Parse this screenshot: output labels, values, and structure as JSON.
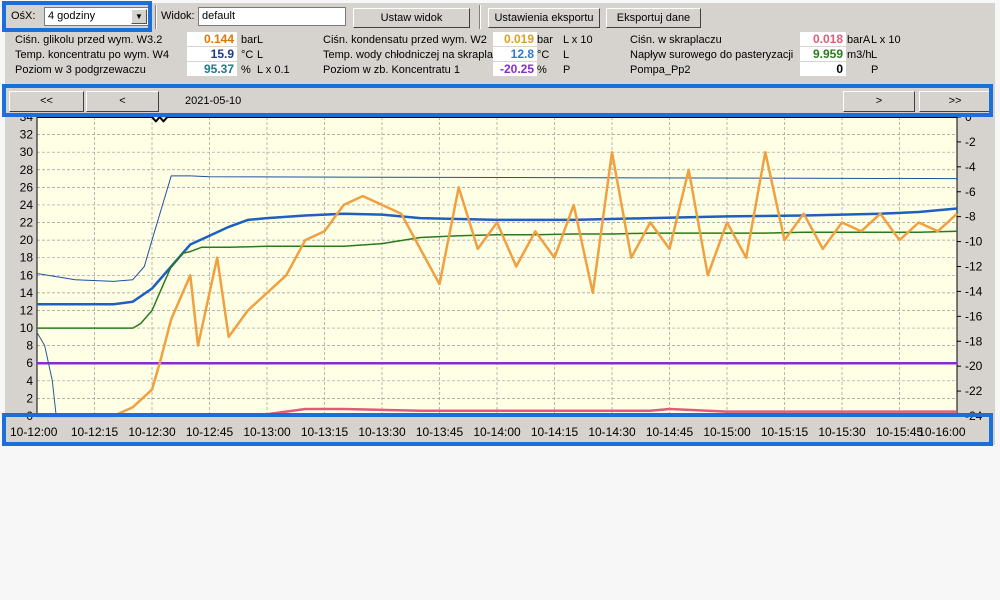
{
  "toolbar": {
    "osx_label": "OśX:",
    "range_value": "4 godziny",
    "view_label": "Widok:",
    "view_value": "default",
    "set_view_button": "Ustaw widok",
    "export_settings_button": "Ustawienia eksportu",
    "export_button": "Eksportuj dane"
  },
  "values": [
    {
      "label": "Ciśn. glikolu przed wym. W3.2",
      "value": "0.144",
      "unit": "bar",
      "scale": "L",
      "color": "#e07800"
    },
    {
      "label": "Temp. koncentratu po wym. W4",
      "value": "15.9",
      "unit": "°C",
      "scale": "L",
      "color": "#1a3a8a"
    },
    {
      "label": "Poziom w 3 podgrzewaczu",
      "value": "95.37",
      "unit": "%",
      "scale": "L x 0.1",
      "color": "#1a7a8a"
    },
    {
      "label": "Ciśn. kondensatu przed wym. W2",
      "value": "0.019",
      "unit": "bar",
      "scale": "L x 10",
      "color": "#e0a020"
    },
    {
      "label": "Temp. wody chłodniczej na skraplacz",
      "value": "12.8",
      "unit": "°C",
      "scale": "L",
      "color": "#2a7ad8"
    },
    {
      "label": "Poziom w zb. Koncentratu 1",
      "value": "-20.25",
      "unit": "%",
      "scale": "P",
      "color": "#8a2ad0"
    },
    {
      "label": "Ciśn. w skraplaczu",
      "value": "0.018",
      "unit": "barA",
      "scale": "L x 10",
      "color": "#e05a7a"
    },
    {
      "label": "Napływ surowego do pasteryzacji",
      "value": "9.959",
      "unit": "m3/h",
      "scale": "L",
      "color": "#2a7a1a"
    },
    {
      "label": "Pompa_Pp2",
      "value": "0",
      "unit": "",
      "scale": "P",
      "color": "#000000"
    }
  ],
  "nav": {
    "first": "<<",
    "prev": "<",
    "date": "2021-05-10",
    "next": ">",
    "last": ">>"
  },
  "chart_data": {
    "type": "line",
    "y_left": {
      "min": 0,
      "max": 34,
      "ticks": [
        0,
        2,
        4,
        6,
        8,
        10,
        12,
        14,
        16,
        18,
        20,
        22,
        24,
        26,
        28,
        30,
        32,
        34
      ]
    },
    "y_right": {
      "min": -24,
      "max": 0,
      "ticks": [
        0,
        -2,
        -4,
        -6,
        -8,
        -10,
        -12,
        -14,
        -16,
        -18,
        -20,
        -22,
        -24
      ]
    },
    "x_ticks": [
      "10-12:00",
      "10-12:15",
      "10-12:30",
      "10-12:45",
      "10-13:00",
      "10-13:15",
      "10-13:30",
      "10-13:45",
      "10-14:00",
      "10-14:15",
      "10-14:30",
      "10-14:45",
      "10-15:00",
      "10-15:15",
      "10-15:30",
      "10-15:45",
      "10-16:00"
    ],
    "grid": true,
    "series": [
      {
        "color": "#1e5fbf",
        "x": [
          0,
          20,
          25,
          30,
          35,
          40,
          45,
          50,
          55,
          60,
          70,
          80,
          90,
          100,
          120,
          140,
          160,
          180,
          200,
          210,
          220,
          230,
          240
        ],
        "y": [
          12.7,
          12.7,
          13,
          14.5,
          17,
          19.5,
          20.5,
          21.5,
          22.3,
          22.5,
          22.8,
          23,
          22.9,
          22.5,
          22.3,
          22.3,
          22.5,
          22.7,
          22.8,
          22.9,
          23,
          23.2,
          23.6
        ]
      },
      {
        "color": "#1e4f9f",
        "x": [
          0,
          10,
          20,
          25,
          28,
          30,
          35,
          40,
          45,
          240
        ],
        "y": [
          16.2,
          15.5,
          15.3,
          15.5,
          17,
          20,
          27.3,
          27.3,
          27.2,
          27
        ]
      },
      {
        "color": "#2a7a1a",
        "x": [
          0,
          20,
          25,
          27,
          30,
          33,
          35,
          38,
          40,
          43,
          45,
          50,
          60,
          70,
          80,
          90,
          100,
          110,
          120,
          130,
          140,
          150,
          160,
          170,
          180,
          190,
          200,
          210,
          220,
          230,
          240
        ],
        "y": [
          10,
          10,
          10,
          10.5,
          12,
          15,
          17,
          18.5,
          18.7,
          19.2,
          19.2,
          19.2,
          19.3,
          19.3,
          19.3,
          19.6,
          20.3,
          20.5,
          20.6,
          20.6,
          20.7,
          20.7,
          20.8,
          20.8,
          20.8,
          20.8,
          20.9,
          20.9,
          20.9,
          20.9,
          21
        ]
      },
      {
        "color": "#8a2ad0",
        "x": [
          0,
          240
        ],
        "y": [
          6,
          6
        ]
      },
      {
        "color": "#e05a7a",
        "x": [
          0,
          60,
          70,
          80,
          100,
          160,
          165,
          180,
          240
        ],
        "y": [
          0.2,
          0.2,
          0.8,
          0.8,
          0.6,
          0.6,
          0.8,
          0.5,
          0.5
        ]
      },
      {
        "color": "#f0a040",
        "x": [
          0,
          20,
          25,
          30,
          32,
          35,
          40,
          42,
          45,
          47,
          50,
          55,
          60,
          65,
          70,
          75,
          80,
          85,
          90,
          95,
          100,
          105,
          110,
          115,
          120,
          125,
          130,
          135,
          140,
          145,
          150,
          155,
          160,
          165,
          170,
          175,
          180,
          185,
          190,
          195,
          200,
          205,
          210,
          215,
          220,
          225,
          230,
          235,
          240
        ],
        "y": [
          0,
          0,
          1,
          3,
          6,
          11,
          16,
          8,
          14,
          18,
          9,
          12,
          14,
          16,
          20,
          21,
          24,
          25,
          24,
          23,
          19,
          15,
          26,
          19,
          22,
          17,
          21,
          18,
          24,
          14,
          30,
          18,
          22,
          19,
          28,
          16,
          22,
          18,
          30,
          20,
          23,
          19,
          22,
          21,
          23,
          20,
          22,
          21,
          23
        ]
      },
      {
        "color": "#2a5a8a",
        "x": [
          0,
          2,
          4,
          5,
          6,
          240
        ],
        "y": [
          9.5,
          8,
          4,
          0,
          0,
          0
        ]
      },
      {
        "color": "#000000",
        "x": [
          0,
          30,
          31,
          32,
          33,
          34,
          35,
          240
        ],
        "y": [
          34,
          34,
          33.5,
          34,
          33.5,
          34,
          34,
          34
        ]
      }
    ]
  }
}
